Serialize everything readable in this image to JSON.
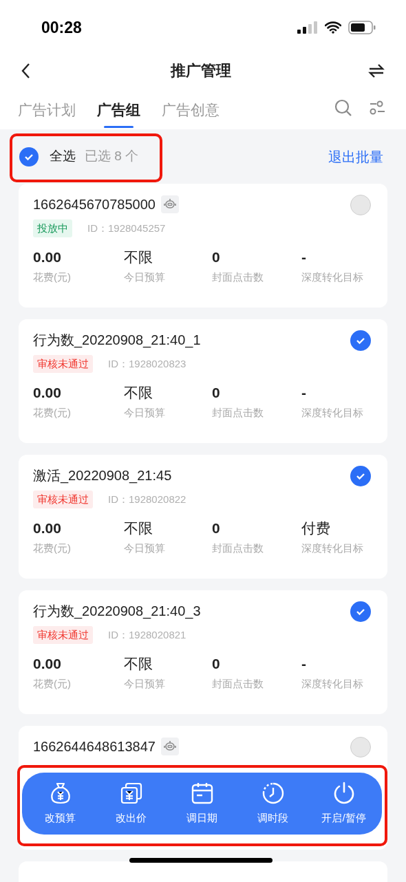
{
  "status_bar": {
    "time": "00:28"
  },
  "header": {
    "title": "推广管理"
  },
  "tabs": [
    {
      "label": "广告计划",
      "selected": false
    },
    {
      "label": "广告组",
      "selected": true
    },
    {
      "label": "广告创意",
      "selected": false
    }
  ],
  "select_bar": {
    "label": "全选",
    "checked": true,
    "count": "已选 8 个",
    "exit": "退出批量",
    "highlighted": true
  },
  "cards": [
    {
      "title": "1662645670785000",
      "robot": true,
      "selected": false,
      "status": {
        "label": "投放中",
        "kind": "running"
      },
      "id": "ID：1928045257",
      "stats": [
        {
          "value": "0.00",
          "label": "花费(元)"
        },
        {
          "value": "不限",
          "label": "今日预算"
        },
        {
          "value": "0",
          "label": "封面点击数"
        },
        {
          "value": "-",
          "label": "深度转化目标"
        }
      ]
    },
    {
      "title": "行为数_20220908_21:40_1",
      "robot": false,
      "selected": true,
      "status": {
        "label": "审核未通过",
        "kind": "rejected"
      },
      "id": "ID：1928020823",
      "stats": [
        {
          "value": "0.00",
          "label": "花费(元)"
        },
        {
          "value": "不限",
          "label": "今日预算"
        },
        {
          "value": "0",
          "label": "封面点击数"
        },
        {
          "value": "-",
          "label": "深度转化目标"
        }
      ]
    },
    {
      "title": "激活_20220908_21:45",
      "robot": false,
      "selected": true,
      "status": {
        "label": "审核未通过",
        "kind": "rejected"
      },
      "id": "ID：1928020822",
      "stats": [
        {
          "value": "0.00",
          "label": "花费(元)"
        },
        {
          "value": "不限",
          "label": "今日预算"
        },
        {
          "value": "0",
          "label": "封面点击数"
        },
        {
          "value": "付费",
          "label": "深度转化目标"
        }
      ]
    },
    {
      "title": "行为数_20220908_21:40_3",
      "robot": false,
      "selected": true,
      "status": {
        "label": "审核未通过",
        "kind": "rejected"
      },
      "id": "ID：1928020821",
      "stats": [
        {
          "value": "0.00",
          "label": "花费(元)"
        },
        {
          "value": "不限",
          "label": "今日预算"
        },
        {
          "value": "0",
          "label": "封面点击数"
        },
        {
          "value": "-",
          "label": "深度转化目标"
        }
      ]
    },
    {
      "title": "1662644648613847",
      "robot": true,
      "selected": false
    }
  ],
  "action_bar": {
    "highlighted": true,
    "actions": [
      {
        "label": "改预算",
        "kind": "budget"
      },
      {
        "label": "改出价",
        "kind": "bid"
      },
      {
        "label": "调日期",
        "kind": "date"
      },
      {
        "label": "调时段",
        "kind": "time"
      },
      {
        "label": "开启/暂停",
        "kind": "power"
      }
    ]
  }
}
